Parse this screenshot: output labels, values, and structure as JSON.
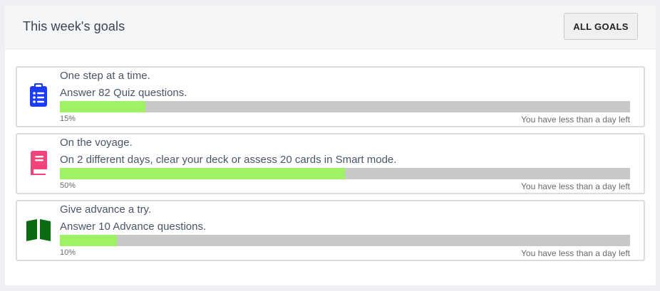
{
  "header": {
    "title": "This week's goals",
    "all_goals_button": "ALL GOALS"
  },
  "goals": [
    {
      "icon": "clipboard-list-icon",
      "icon_color": "#1a3cf5",
      "title": "One step at a time.",
      "description": "Answer 82 Quiz questions.",
      "progress": 0.15,
      "progress_label": "15%",
      "time_left": "You have less than a day left"
    },
    {
      "icon": "book-icon",
      "icon_color": "#f0457a",
      "title": "On the voyage.",
      "description": "On 2 different days, clear your deck or assess 20 cards in Smart mode.",
      "progress": 0.5,
      "progress_label": "50%",
      "time_left": "You have less than a day left"
    },
    {
      "icon": "open-book-icon",
      "icon_color": "#0a6b12",
      "title": "Give advance a try.",
      "description": "Answer 10 Advance questions.",
      "progress": 0.1,
      "progress_label": "10%",
      "time_left": "You have less than a day left"
    }
  ],
  "colors": {
    "progress_fill": "#9ef264",
    "progress_track": "#c8c8c8"
  }
}
